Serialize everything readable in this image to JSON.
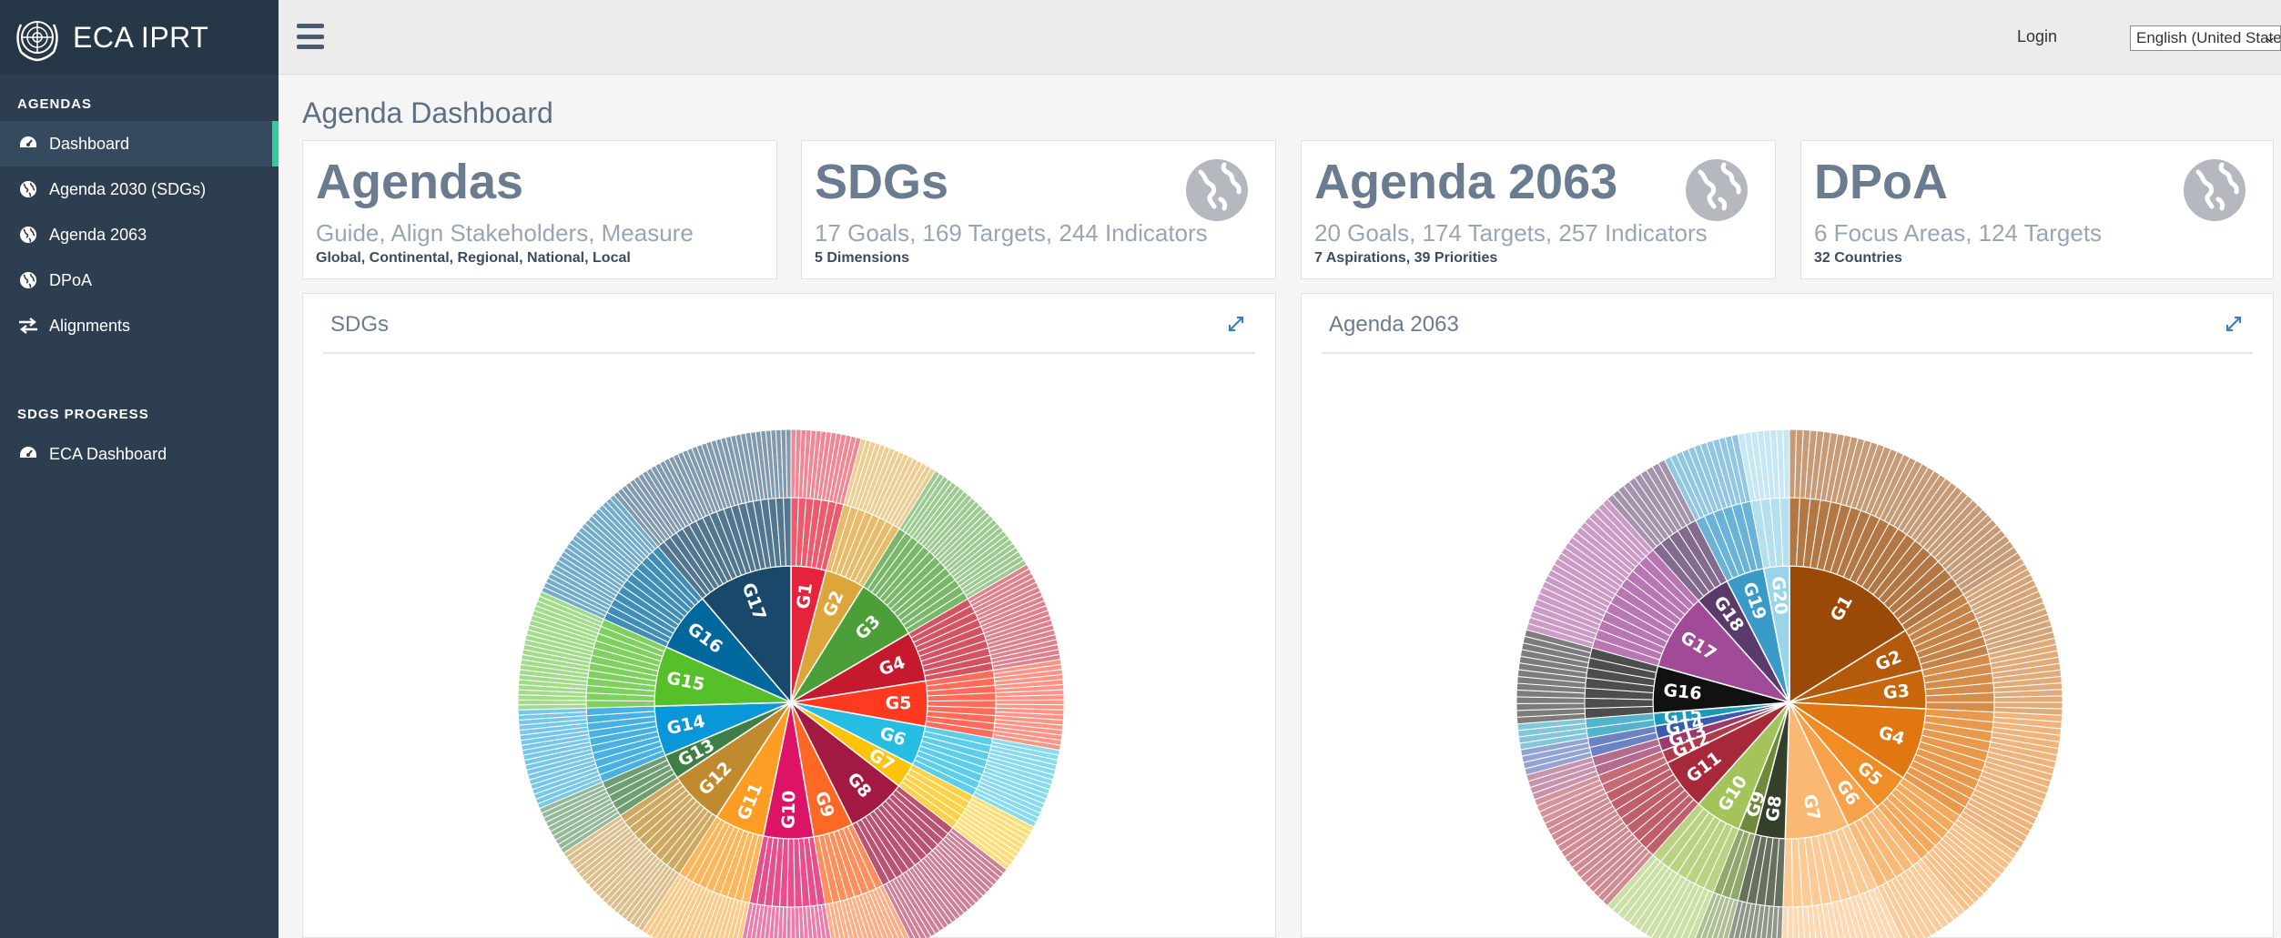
{
  "brand": {
    "name": "ECA IPRT"
  },
  "sidebar": {
    "sections": [
      {
        "title": "AGENDAS",
        "items": [
          {
            "label": "Dashboard",
            "icon": "dashboard-icon",
            "active": true
          },
          {
            "label": "Agenda 2030 (SDGs)",
            "icon": "globe-icon"
          },
          {
            "label": "Agenda 2063",
            "icon": "globe-icon"
          },
          {
            "label": "DPoA",
            "icon": "globe-icon"
          },
          {
            "label": "Alignments",
            "icon": "exchange-icon"
          }
        ]
      },
      {
        "title": "SDGS PROGRESS",
        "items": [
          {
            "label": "ECA Dashboard",
            "icon": "dashboard-icon"
          }
        ]
      }
    ]
  },
  "topbar": {
    "login": "Login",
    "language": "English (United States)"
  },
  "page": {
    "title": "Agenda Dashboard"
  },
  "cards": [
    {
      "title": "Agendas",
      "subtitle": "Guide, Align Stakeholders, Measure",
      "detail": "Global, Continental, Regional, National, Local",
      "icon": ""
    },
    {
      "title": "SDGs",
      "subtitle": "17 Goals, 169 Targets, 244 Indicators",
      "detail": "5 Dimensions",
      "icon": "globe-icon"
    },
    {
      "title": "Agenda 2063",
      "subtitle": "20 Goals, 174 Targets, 257 Indicators",
      "detail": "7 Aspirations, 39 Priorities",
      "icon": "globe-icon"
    },
    {
      "title": "DPoA",
      "subtitle": "6 Focus Areas, 124 Targets",
      "detail": "32 Countries",
      "icon": "globe-icon"
    }
  ],
  "panels": [
    {
      "title": "SDGs"
    },
    {
      "title": "Agenda 2063"
    }
  ],
  "chart_data": [
    {
      "type": "sunburst",
      "title": "",
      "rings": [
        "goal",
        "target",
        "indicator"
      ],
      "labels": [
        "G1",
        "G2",
        "G3",
        "G4",
        "G5",
        "G6",
        "G7",
        "G8",
        "G9",
        "G10",
        "G11",
        "G12",
        "G13",
        "G14",
        "G15",
        "G16",
        "G17"
      ],
      "values": [
        7,
        8,
        13,
        10,
        9,
        8,
        5,
        12,
        8,
        10,
        10,
        11,
        5,
        10,
        12,
        12,
        19
      ],
      "target_counts": [
        7,
        8,
        13,
        10,
        9,
        8,
        5,
        12,
        8,
        10,
        10,
        11,
        5,
        10,
        12,
        12,
        19
      ],
      "colors": [
        "#e5243b",
        "#dda63a",
        "#4c9f38",
        "#c5192d",
        "#ff3a21",
        "#26bde2",
        "#fcc30b",
        "#a21942",
        "#fd6925",
        "#dd1367",
        "#fd9d24",
        "#bf8b2e",
        "#3f7e44",
        "#0a97d9",
        "#56c02b",
        "#00689d",
        "#19486a"
      ]
    },
    {
      "type": "sunburst",
      "title": "",
      "rings": [
        "goal",
        "target",
        "indicator"
      ],
      "labels": [
        "G1",
        "G2",
        "G3",
        "G4",
        "G5",
        "G6",
        "G7",
        "G8",
        "G9",
        "G10",
        "G11",
        "G12",
        "G13",
        "G14",
        "G15",
        "G16",
        "G17",
        "G18",
        "G19",
        "G20"
      ],
      "values": [
        32,
        10,
        9,
        17,
        9,
        8,
        15,
        7,
        4,
        11,
        12,
        3,
        3,
        3,
        3,
        11,
        18,
        8,
        9,
        6
      ],
      "target_counts": [
        20,
        7,
        6,
        11,
        6,
        5,
        10,
        5,
        3,
        7,
        8,
        2,
        2,
        2,
        2,
        7,
        12,
        5,
        6,
        4
      ],
      "colors": [
        "#9a4a06",
        "#b25a0a",
        "#c8670c",
        "#e07710",
        "#f08d25",
        "#f7a24a",
        "#fbb872",
        "#34402a",
        "#6e8a3a",
        "#a2c45a",
        "#a82a3a",
        "#b03a48",
        "#9a3a6a",
        "#3a5ab0",
        "#1a9ab8",
        "#111111",
        "#a04a98",
        "#5a3a6a",
        "#3a9ac8",
        "#9ad4e8"
      ]
    }
  ]
}
